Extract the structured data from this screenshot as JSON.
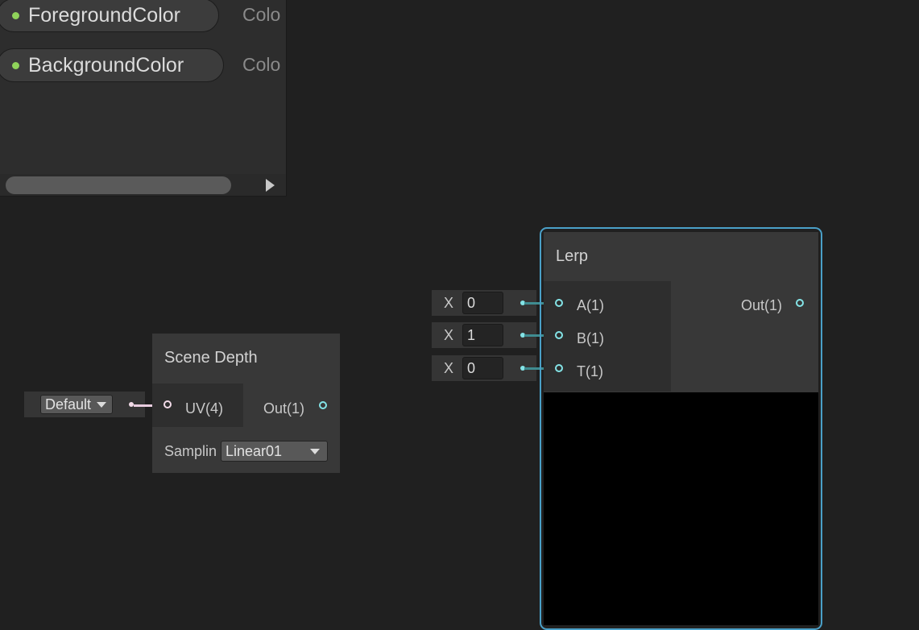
{
  "blackboard": {
    "properties": [
      {
        "name": "ForegroundColor",
        "type": "Colo"
      },
      {
        "name": "BackgroundColor",
        "type": "Colo"
      }
    ],
    "scroll_right_icon": "triangle-right-icon"
  },
  "scene_depth_node": {
    "title": "Scene Depth",
    "input_port": "UV(4)",
    "output_port": "Out(1)",
    "uv_dropdown": "Default",
    "sampling_label": "Samplin",
    "sampling_value": "Linear01"
  },
  "lerp_node": {
    "title": "Lerp",
    "inputs": [
      {
        "label": "A(1)",
        "axis": "X",
        "value": "0"
      },
      {
        "label": "B(1)",
        "axis": "X",
        "value": "1"
      },
      {
        "label": "T(1)",
        "axis": "X",
        "value": "0"
      }
    ],
    "output_port": "Out(1)"
  },
  "colors": {
    "background": "#202020",
    "node": "#383838",
    "selection_outline": "#4aa0c8",
    "vector1_port": "#84e4e7",
    "vector4_port": "#f2dbe8",
    "property_dot": "#8fd35a",
    "preview": "#000000"
  }
}
